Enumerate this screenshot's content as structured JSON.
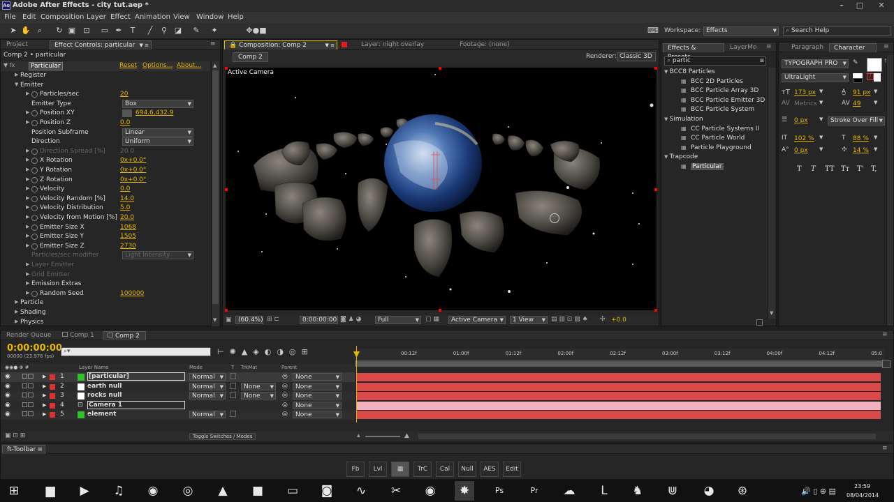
{
  "window": {
    "title": "Adobe After Effects - city tut.aep *",
    "app_icon": "Ae"
  },
  "menu": [
    "File",
    "Edit",
    "Composition",
    "Layer",
    "Effect",
    "Animation",
    "View",
    "Window",
    "Help"
  ],
  "workspace": {
    "label": "Workspace:",
    "value": "Effects",
    "search_placeholder": "Search Help"
  },
  "effect_panel": {
    "tabs": [
      "Project",
      "Effect Controls: particular"
    ],
    "breadcrumb": "Comp 2 • particular",
    "effect_name": "Particular",
    "links": [
      "Reset",
      "Options...",
      "About..."
    ],
    "rows": [
      {
        "label": "Register",
        "indent": 1,
        "type": "group"
      },
      {
        "label": "Emitter",
        "indent": 1,
        "type": "group_open"
      },
      {
        "label": "Particles/sec",
        "indent": 2,
        "value": "20"
      },
      {
        "label": "Emitter Type",
        "indent": 2,
        "dropdown": "Box"
      },
      {
        "label": "Position XY",
        "indent": 2,
        "value": "694.6,432.9"
      },
      {
        "label": "Position Z",
        "indent": 2,
        "value": "0.0"
      },
      {
        "label": "Position Subframe",
        "indent": 2,
        "dropdown": "Linear"
      },
      {
        "label": "Direction",
        "indent": 2,
        "dropdown": "Uniform"
      },
      {
        "label": "Direction Spread [%]",
        "indent": 2,
        "value": "20.0",
        "disabled": true
      },
      {
        "label": "X Rotation",
        "indent": 2,
        "value": "0x+0.0°"
      },
      {
        "label": "Y Rotation",
        "indent": 2,
        "value": "0x+0.0°"
      },
      {
        "label": "Z Rotation",
        "indent": 2,
        "value": "0x+0.0°"
      },
      {
        "label": "Velocity",
        "indent": 2,
        "value": "0.0"
      },
      {
        "label": "Velocity Random [%]",
        "indent": 2,
        "value": "14.0"
      },
      {
        "label": "Velocity Distribution",
        "indent": 2,
        "value": "5.0"
      },
      {
        "label": "Velocity from Motion [%]",
        "indent": 2,
        "value": "20.0"
      },
      {
        "label": "Emitter Size X",
        "indent": 2,
        "value": "1068"
      },
      {
        "label": "Emitter Size Y",
        "indent": 2,
        "value": "1505"
      },
      {
        "label": "Emitter Size Z",
        "indent": 2,
        "value": "2730"
      },
      {
        "label": "Particles/sec modifier",
        "indent": 2,
        "dropdown": "Light Intensity",
        "disabled": true
      },
      {
        "label": "Layer Emitter",
        "indent": 2,
        "disabled": true,
        "type": "group"
      },
      {
        "label": "Grid Emitter",
        "indent": 2,
        "disabled": true,
        "type": "group"
      },
      {
        "label": "Emission Extras",
        "indent": 2,
        "type": "group"
      },
      {
        "label": "Random Seed",
        "indent": 2,
        "value": "100000"
      },
      {
        "label": "Particle",
        "indent": 1,
        "type": "group"
      },
      {
        "label": "Shading",
        "indent": 1,
        "type": "group"
      },
      {
        "label": "Physics",
        "indent": 1,
        "type": "group"
      }
    ]
  },
  "comp_panel": {
    "tabs": [
      "Composition: Comp 2",
      "Layer: night overlay",
      "Footage: (none)"
    ],
    "sub_tab": "Comp 2",
    "renderer_label": "Renderer:",
    "renderer": "Classic 3D",
    "view_label": "Active Camera",
    "footer": {
      "zoom": "(60.4%)",
      "timecode": "0:00:00:00",
      "resolution": "Full",
      "camera": "Active Camera",
      "views": "1 View",
      "exposure": "+0.0"
    }
  },
  "effects_presets": {
    "tabs": [
      "Effects & Presets",
      "LayerMo"
    ],
    "search": "partic",
    "groups": [
      {
        "name": "BCC8 Particles",
        "items": [
          "BCC 2D Particles",
          "BCC Particle Array 3D",
          "BCC Particle Emitter 3D",
          "BCC Particle System"
        ]
      },
      {
        "name": "Simulation",
        "items": [
          "CC Particle Systems II",
          "CC Particle World",
          "Particle Playground"
        ]
      },
      {
        "name": "Trapcode",
        "items": [
          "Particular"
        ]
      }
    ]
  },
  "character": {
    "tabs": [
      "Paragraph",
      "Character"
    ],
    "font": "TYPOGRAPH PRO",
    "style": "UltraLight",
    "size": "173 px",
    "leading": "91 px",
    "kerning": "Metrics",
    "tracking": "49",
    "stroke_width": "0 px",
    "stroke_mode": "Stroke Over Fill",
    "vscale": "102 %",
    "hscale": "88 %",
    "baseline": "0 px",
    "tsume": "14 %",
    "styles": [
      "T",
      "T",
      "TT",
      "Tт",
      "T'",
      "T,"
    ]
  },
  "timeline": {
    "tabs": [
      "Render Queue",
      "Comp 1",
      "Comp 2"
    ],
    "timecode": "0:00:00:00",
    "fps": "00000 (23.976 fps)",
    "headers": {
      "layer_name": "Layer Name",
      "mode": "Mode",
      "t": "T",
      "trkmat": "TrkMat",
      "parent": "Parent"
    },
    "layers": [
      {
        "num": "1",
        "name": "[particular]",
        "color": "#2ec22e",
        "mode": "Normal",
        "trkmat": "",
        "parent": "None",
        "selected": true
      },
      {
        "num": "2",
        "name": "earth null",
        "color": "#ffffff",
        "mode": "Normal",
        "trkmat": "None",
        "parent": "None"
      },
      {
        "num": "3",
        "name": "rocks null",
        "color": "#ffffff",
        "mode": "Normal",
        "trkmat": "None",
        "parent": "None"
      },
      {
        "num": "4",
        "name": "Camera 1",
        "color": "#f4a6b8",
        "mode": "",
        "trkmat": "",
        "parent": "None",
        "camera": true
      },
      {
        "num": "5",
        "name": "element",
        "color": "#2ec22e",
        "mode": "Normal",
        "trkmat": "",
        "parent": "None"
      }
    ],
    "ruler": [
      "00:12f",
      "01:00f",
      "01:12f",
      "02:00f",
      "02:12f",
      "03:00f",
      "03:12f",
      "04:00f",
      "04:12f",
      "05:0"
    ],
    "toggle_label": "Toggle Switches / Modes"
  },
  "ft_toolbar": {
    "title": "ft-Toolbar",
    "buttons": [
      "Fb",
      "Lvl",
      "▦",
      "TrC",
      "Cal",
      "Null",
      "AES",
      "Edit"
    ]
  },
  "taskbar": {
    "time": "23:59",
    "date": "08/04/2014"
  }
}
